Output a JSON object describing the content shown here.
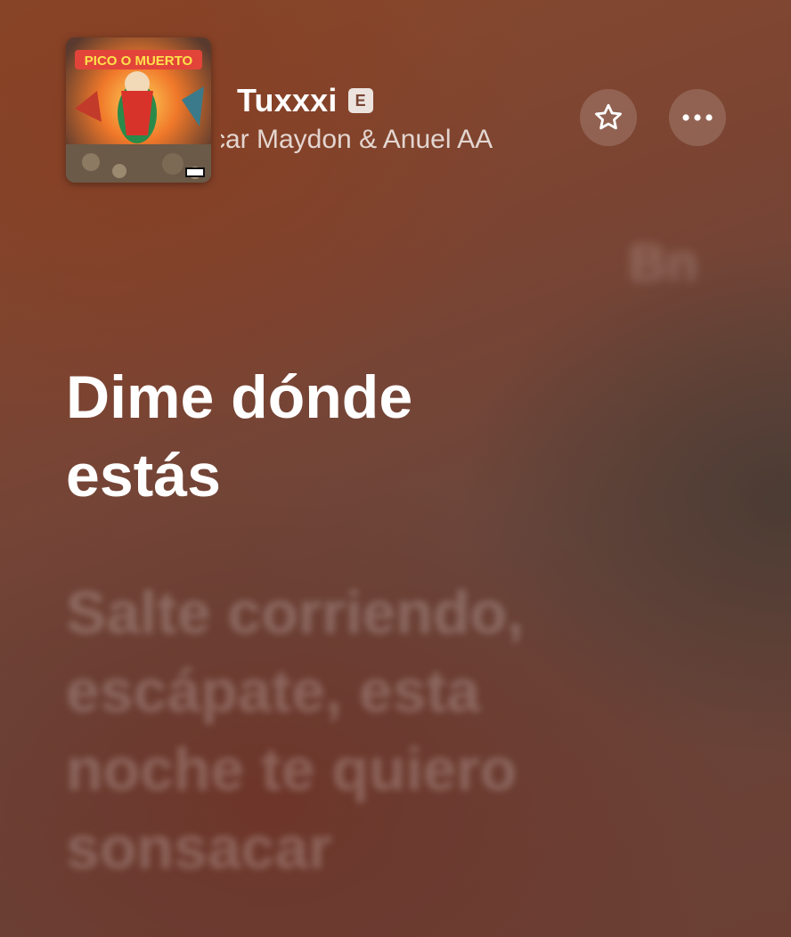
{
  "now_playing": {
    "title": "Tuxxxi",
    "explicit_badge": "E",
    "artist": "car Maydon & Anuel AA",
    "artwork_title": "PICO O MUERTO",
    "favorite_icon": "star-outline-icon",
    "more_icon": "ellipsis-icon"
  },
  "lyrics": {
    "previous_line": "Bn",
    "current_line": "Dime dónde estás",
    "next_line": "Salte corriendo, escápate, esta noche te quiero sonsacar"
  },
  "colors": {
    "background_primary": "#8a4a2c",
    "background_secondary": "#6a463c",
    "text_primary": "#ffffff"
  }
}
